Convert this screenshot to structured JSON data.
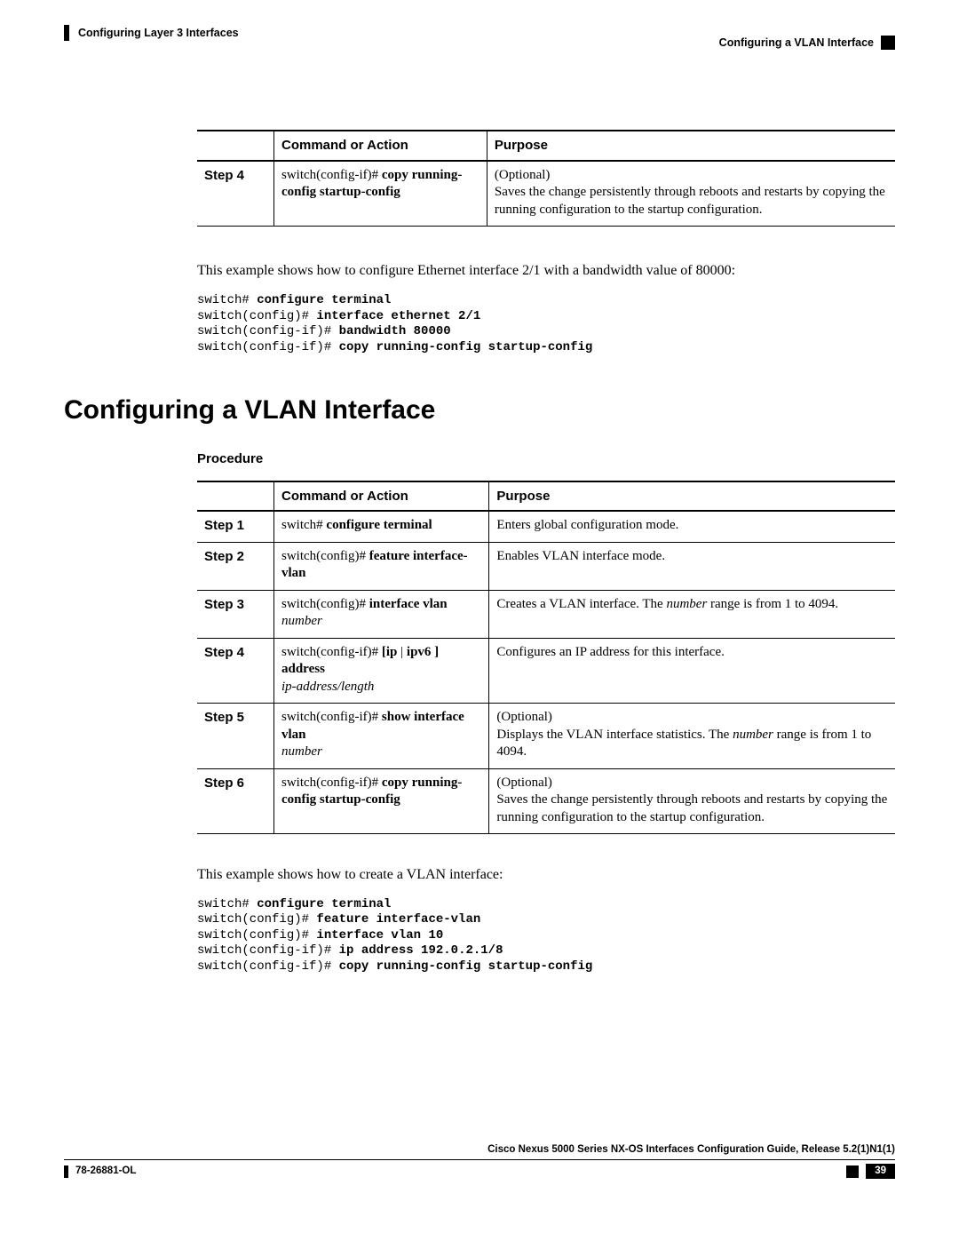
{
  "header": {
    "chapter": "Configuring Layer 3 Interfaces",
    "section": "Configuring a VLAN Interface"
  },
  "table1": {
    "headers": {
      "step": "",
      "cmd": "Command or Action",
      "purpose": "Purpose"
    },
    "row": {
      "step": "Step 4",
      "cmd_prefix": "switch(config-if)# ",
      "cmd_bold": "copy running-config startup-config",
      "purpose_line1": "(Optional)",
      "purpose_line2": "Saves the change persistently through reboots and restarts by copying the running configuration to the startup configuration."
    }
  },
  "para1": "This example shows how to configure Ethernet interface 2/1 with a bandwidth value of 80000:",
  "code1": {
    "l1p": "switch# ",
    "l1b": "configure terminal",
    "l2p": "switch(config)# ",
    "l2b": "interface ethernet 2/1",
    "l3p": "switch(config-if)# ",
    "l3b": "bandwidth 80000",
    "l4p": "switch(config-if)# ",
    "l4b": "copy running-config startup-config"
  },
  "section_title": "Configuring a VLAN Interface",
  "procedure_label": "Procedure",
  "table2": {
    "headers": {
      "step": "",
      "cmd": "Command or Action",
      "purpose": "Purpose"
    },
    "rows": [
      {
        "step": "Step 1",
        "cmd_prefix": "switch# ",
        "cmd_bold": "configure terminal",
        "cmd_italic": "",
        "purpose": "Enters global configuration mode."
      },
      {
        "step": "Step 2",
        "cmd_prefix": "switch(config)# ",
        "cmd_bold": "feature interface-vlan",
        "cmd_italic": "",
        "purpose": "Enables VLAN interface mode."
      },
      {
        "step": "Step 3",
        "cmd_prefix": "switch(config)# ",
        "cmd_bold": "interface vlan ",
        "cmd_italic": "number",
        "purpose_pre": "Creates a VLAN interface. The ",
        "purpose_italic": "number",
        "purpose_post": " range is from 1 to 4094."
      },
      {
        "step": "Step 4",
        "cmd_prefix": "switch(config-if)# ",
        "cmd_bold_pre": "[ip ",
        "cmd_bold_mid": "| ",
        "cmd_bold_post": "ipv6 ] address",
        "cmd_italic_line2": "ip-address/length",
        "purpose": "Configures an IP address for this interface."
      },
      {
        "step": "Step 5",
        "cmd_prefix": "switch(config-if)# ",
        "cmd_bold": "show interface vlan",
        "cmd_italic_line2": "number",
        "purpose_line1": "(Optional)",
        "purpose_line2_pre": "Displays the VLAN interface statistics. The ",
        "purpose_line2_italic": "number",
        "purpose_line2_post": " range is from 1 to 4094."
      },
      {
        "step": "Step 6",
        "cmd_prefix": "switch(config-if)# ",
        "cmd_bold": "copy running-config startup-config",
        "cmd_italic": "",
        "purpose_line1": "(Optional)",
        "purpose_line2": "Saves the change persistently through reboots and restarts by copying the running configuration to the startup configuration."
      }
    ]
  },
  "para2": "This example shows how to create a VLAN interface:",
  "code2": {
    "l1p": "switch# ",
    "l1b": "configure terminal",
    "l2p": "switch(config)# ",
    "l2b": "feature interface-vlan",
    "l3p": "switch(config)# ",
    "l3b": "interface vlan 10",
    "l4p": "switch(config-if)# ",
    "l4b": "ip address 192.0.2.1/8",
    "l5p": "switch(config-if)# ",
    "l5b": "copy running-config startup-config"
  },
  "footer": {
    "guide": "Cisco Nexus 5000 Series NX-OS Interfaces Configuration Guide, Release 5.2(1)N1(1)",
    "doc": "78-26881-OL",
    "page": "39"
  }
}
